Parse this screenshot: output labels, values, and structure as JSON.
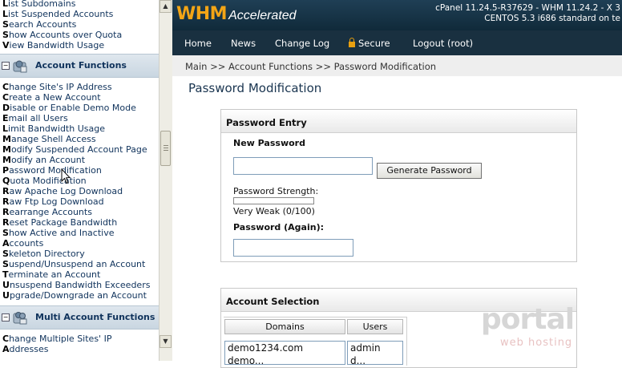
{
  "sidebar": {
    "top_links": [
      "List Subdomains",
      "List Suspended Accounts",
      "Search Accounts",
      "Show Accounts over Quota",
      "View Bandwidth Usage"
    ],
    "sections": [
      {
        "title": "Account Functions",
        "toggle": "−",
        "links": [
          "Change Site's IP Address",
          "Create a New Account",
          "Disable or Enable Demo Mode",
          "Email all Users",
          "Limit Bandwidth Usage",
          "Manage Shell Access",
          "Modify Suspended Account Page",
          "Modify an Account",
          "Password Modification",
          "Quota Modification",
          "Raw Apache Log Download",
          "Raw Ftp Log Download",
          "Rearrange Accounts",
          "Reset Package Bandwidth",
          "Show Active and Inactive",
          "Accounts",
          "Skeleton Directory",
          "Suspend/Unsuspend an Account",
          "Terminate an Account",
          "Unsuspend Bandwidth Exceeders",
          "Upgrade/Downgrade an Account"
        ]
      },
      {
        "title": "Multi Account Functions",
        "toggle": "−",
        "links": [
          "Change Multiple Sites' IP",
          "Addresses"
        ]
      }
    ]
  },
  "header": {
    "logo_whm": "WHM",
    "logo_accelerated": "Accelerated",
    "version_line1": "cPanel 11.24.5-R37629 - WHM 11.24.2 - X 3",
    "version_line2": "CENTOS 5.3 i686 standard on te"
  },
  "nav": {
    "home": "Home",
    "news": "News",
    "changelog": "Change Log",
    "secure": "Secure",
    "logout": "Logout (root)"
  },
  "breadcrumb": "Main >> Account Functions >> Password Modification",
  "page_title": "Password Modification",
  "password_entry": {
    "heading": "Password Entry",
    "new_password_label": "New Password",
    "new_password_value": "",
    "generate_button": "Generate Password",
    "strength_label": "Password Strength:",
    "strength_value": "Very Weak (0/100)",
    "strength_fraction": 0,
    "again_label": "Password (Again):",
    "again_value": ""
  },
  "account_selection": {
    "heading": "Account Selection",
    "col_domains": "Domains",
    "col_users": "Users",
    "domains": [
      "demo1234.com",
      "demo..."
    ],
    "users": [
      "admin",
      "d..."
    ]
  },
  "watermark": {
    "line1": "portal",
    "line2": "web hosting"
  },
  "colors": {
    "header_bg": "#102a3a",
    "logo_orange": "#f3a516",
    "link_blue": "#10335c"
  }
}
